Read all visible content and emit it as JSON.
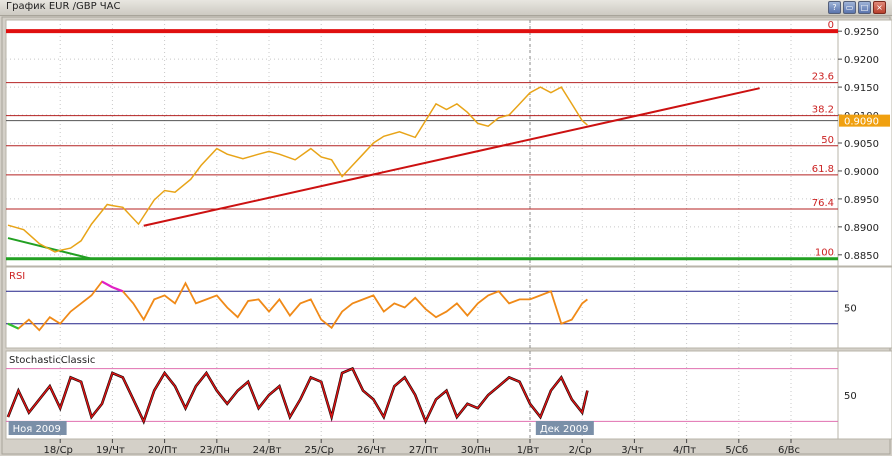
{
  "window": {
    "title": "График EUR /GBP  ЧАС",
    "buttons": [
      {
        "name": "window-help-button",
        "glyph": "?"
      },
      {
        "name": "window-minimize-button",
        "glyph": "▭"
      },
      {
        "name": "window-maximize-button",
        "glyph": "□"
      },
      {
        "name": "window-close-button",
        "glyph": "×"
      }
    ]
  },
  "colors": {
    "price": "#e8a418",
    "trendline": "#cc1111",
    "fib_line": "#b42222",
    "fib_text": "#cc2222",
    "level_zero": "#e01010",
    "level_hundred": "#22a022",
    "rsi_line": "#f08a18",
    "rsi_overbought": "#e020c8",
    "rsi_oversold": "#30c030",
    "rsi_band": "#222288",
    "stoch_main": "#1a0505",
    "stoch_signal": "#e01515",
    "stoch_band": "#e070b0",
    "current_price_bg": "#f0a010"
  },
  "chart_data": [
    {
      "type": "line",
      "symbol": "EUR/GBP",
      "timeframe": "ЧАС",
      "x_ticks": [
        "18/Ср",
        "19/Чт",
        "20/Пт",
        "23/Пн",
        "24/Вт",
        "25/Ср",
        "26/Чт",
        "27/Пт",
        "30/Пн",
        "1/Вт",
        "2/Ср",
        "3/Чт",
        "4/Пт",
        "5/Сб",
        "6/Вс"
      ],
      "x_ticks_idx": [
        1,
        2,
        3,
        4,
        5,
        6,
        7,
        8,
        9,
        10,
        11,
        12,
        13,
        14,
        15
      ],
      "x_month_labels": [
        {
          "text": "Ноя 2009",
          "idx": 0.05
        },
        {
          "text": "Дек 2009",
          "idx": 10.15
        }
      ],
      "month_separator_idx": 10.0,
      "y_ticks": [
        "0.9250",
        "0.9200",
        "0.9150",
        "0.9100",
        "0.9050",
        "0.9000",
        "0.8950",
        "0.8900",
        "0.8850"
      ],
      "ylim": [
        0.883,
        0.927
      ],
      "current_price": "0.9090",
      "series": [
        {
          "x": [
            0,
            0.3,
            0.6,
            0.9,
            1.0,
            1.2,
            1.4,
            1.6,
            1.9,
            2.0,
            2.2,
            2.5,
            2.8,
            3.0,
            3.2,
            3.5,
            3.7,
            4.0,
            4.2,
            4.5,
            4.8,
            5.0,
            5.2,
            5.5,
            5.8,
            6.0,
            6.2,
            6.4,
            6.6,
            6.8,
            7.0,
            7.2,
            7.5,
            7.8,
            8.0,
            8.2,
            8.4,
            8.6,
            8.8,
            9.0,
            9.2,
            9.4,
            9.6,
            9.8,
            10.0,
            10.2,
            10.4,
            10.6,
            10.8,
            11.0,
            11.1
          ],
          "y": [
            0.8903,
            0.8895,
            0.887,
            0.8855,
            0.8858,
            0.8862,
            0.8875,
            0.8905,
            0.894,
            0.8938,
            0.8935,
            0.8905,
            0.8948,
            0.8965,
            0.8962,
            0.8985,
            0.901,
            0.904,
            0.903,
            0.9022,
            0.903,
            0.9035,
            0.903,
            0.902,
            0.904,
            0.9025,
            0.902,
            0.899,
            0.901,
            0.903,
            0.905,
            0.9062,
            0.907,
            0.906,
            0.909,
            0.912,
            0.911,
            0.912,
            0.9105,
            0.9085,
            0.908,
            0.9095,
            0.91,
            0.912,
            0.914,
            0.915,
            0.914,
            0.915,
            0.912,
            0.909,
            0.9082
          ]
        }
      ],
      "fibonacci": [
        {
          "label": "0",
          "price": 0.925
        },
        {
          "label": "23.6",
          "price": 0.9158
        },
        {
          "label": "38.2",
          "price": 0.9099
        },
        {
          "label": "50",
          "price": 0.9045
        },
        {
          "label": "61.8",
          "price": 0.8993
        },
        {
          "label": "76.4",
          "price": 0.8932
        },
        {
          "label": "100",
          "price": 0.8843
        }
      ],
      "trendlines": [
        {
          "x": [
            2.6,
            14.4
          ],
          "y": [
            0.8902,
            0.9148
          ],
          "color": "trendline"
        },
        {
          "x": [
            0.0,
            1.6
          ],
          "y": [
            0.888,
            0.8843
          ],
          "color": "level_hundred"
        }
      ]
    },
    {
      "type": "line",
      "title": "RSI",
      "y_ticks": [
        "50"
      ],
      "ylim": [
        0,
        100
      ],
      "bands": [
        70,
        30
      ],
      "series": [
        {
          "x": [
            0,
            0.2,
            0.4,
            0.6,
            0.8,
            1.0,
            1.2,
            1.4,
            1.6,
            1.8,
            2.0,
            2.2,
            2.4,
            2.6,
            2.8,
            3.0,
            3.2,
            3.4,
            3.6,
            3.8,
            4.0,
            4.2,
            4.4,
            4.6,
            4.8,
            5.0,
            5.2,
            5.4,
            5.6,
            5.8,
            6.0,
            6.2,
            6.4,
            6.6,
            6.8,
            7.0,
            7.2,
            7.4,
            7.6,
            7.8,
            8.0,
            8.2,
            8.4,
            8.6,
            8.8,
            9.0,
            9.2,
            9.4,
            9.6,
            9.8,
            10.0,
            10.2,
            10.4,
            10.6,
            10.8,
            11.0,
            11.1
          ],
          "y": [
            30,
            24,
            35,
            22,
            38,
            30,
            45,
            55,
            65,
            82,
            75,
            70,
            55,
            35,
            60,
            65,
            55,
            80,
            55,
            60,
            65,
            50,
            38,
            58,
            60,
            45,
            60,
            40,
            55,
            60,
            35,
            25,
            45,
            55,
            60,
            65,
            45,
            55,
            50,
            62,
            48,
            38,
            45,
            55,
            40,
            55,
            65,
            70,
            55,
            60,
            60,
            65,
            70,
            30,
            35,
            55,
            60
          ]
        }
      ]
    },
    {
      "type": "line",
      "title": "StochasticClassic",
      "y_ticks": [
        "50"
      ],
      "ylim": [
        0,
        100
      ],
      "bands": [
        80,
        20
      ],
      "series": [
        {
          "x": [
            0,
            0.2,
            0.4,
            0.6,
            0.8,
            1.0,
            1.2,
            1.4,
            1.6,
            1.8,
            2.0,
            2.2,
            2.4,
            2.6,
            2.8,
            3.0,
            3.2,
            3.4,
            3.6,
            3.8,
            4.0,
            4.2,
            4.4,
            4.6,
            4.8,
            5.0,
            5.2,
            5.4,
            5.6,
            5.8,
            6.0,
            6.2,
            6.4,
            6.6,
            6.8,
            7.0,
            7.2,
            7.4,
            7.6,
            7.8,
            8.0,
            8.2,
            8.4,
            8.6,
            8.8,
            9.0,
            9.2,
            9.4,
            9.6,
            9.8,
            10.0,
            10.2,
            10.4,
            10.6,
            10.8,
            11.0,
            11.1
          ],
          "y": [
            25,
            55,
            30,
            45,
            60,
            35,
            70,
            65,
            25,
            40,
            75,
            70,
            45,
            20,
            55,
            75,
            60,
            35,
            60,
            75,
            55,
            40,
            55,
            65,
            35,
            50,
            60,
            25,
            45,
            70,
            65,
            25,
            75,
            80,
            55,
            45,
            25,
            60,
            70,
            50,
            20,
            45,
            55,
            25,
            40,
            35,
            50,
            60,
            70,
            65,
            40,
            25,
            55,
            70,
            45,
            30,
            55
          ]
        }
      ]
    }
  ]
}
